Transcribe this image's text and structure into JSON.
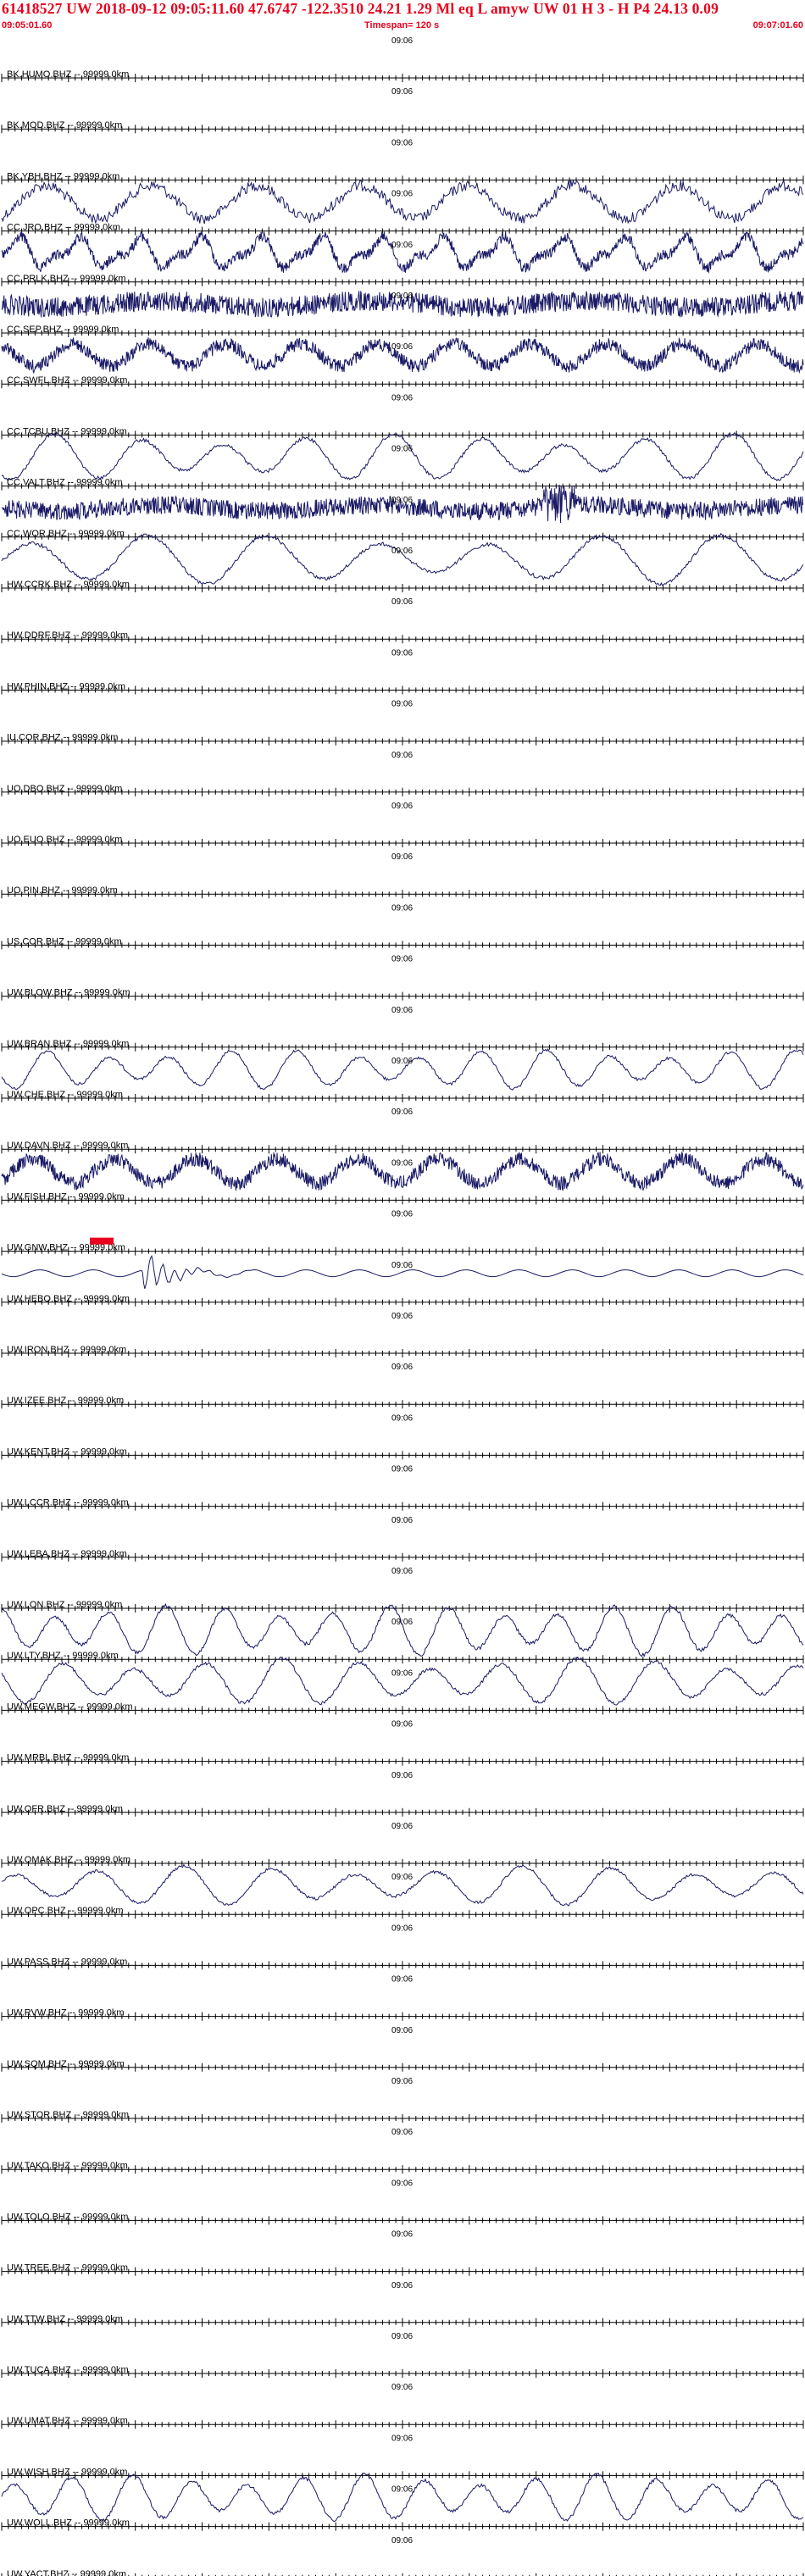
{
  "header": {
    "title": "61418527 UW 2018-09-12 09:05:11.60    47.6747 -122.3510  24.21  1.29 Ml  eq  L amyw     UW 01  H   3   -  H P4   24.13  0.09",
    "start_time": "09:05:01.60",
    "timespan": "Timespan= 120 s",
    "end_time": "09:07:01.60"
  },
  "colors": {
    "header": "#e8001c",
    "trace": "#1a1a66",
    "axis": "#000000",
    "pick": "#e8001c"
  },
  "chart_data": {
    "type": "line",
    "title": "61418527 UW 2018-09-12 09:05:11.60",
    "time_label": "09:06",
    "xlim": [
      0,
      120
    ],
    "traces": [
      {
        "label": "BK.HUMO.BHZ -- 99999.0km",
        "amp": 0,
        "mode": "flat"
      },
      {
        "label": "BK.MOD.BHZ -- 99999.0km",
        "amp": 0,
        "mode": "flat"
      },
      {
        "label": "BK.YBH.BHZ -- 99999.0km",
        "amp": 28,
        "mode": "mixed"
      },
      {
        "label": "CC.JRO.BHZ -- 99999.0km",
        "amp": 24,
        "mode": "fast"
      },
      {
        "label": "CC.PRLK.BHZ -- 99999.0km",
        "amp": 20,
        "mode": "noise"
      },
      {
        "label": "CC.SEP.BHZ -- 99999.0km",
        "amp": 22,
        "mode": "noisy"
      },
      {
        "label": "CC.SWFL.BHZ -- 99999.0km",
        "amp": 0,
        "mode": "flat"
      },
      {
        "label": "CC.TCBU.BHZ -- 99999.0km",
        "amp": 26,
        "mode": "slow"
      },
      {
        "label": "CC.VALT.BHZ -- 99999.0km",
        "amp": 18,
        "mode": "noise"
      },
      {
        "label": "CC.WOR.BHZ -- 99999.0km",
        "amp": 28,
        "mode": "slow"
      },
      {
        "label": "HW.CCRK.BHZ -- 99999.0km",
        "amp": 0,
        "mode": "flat"
      },
      {
        "label": "HW.DDRF.BHZ -- 99999.0km",
        "amp": 0,
        "mode": "flat"
      },
      {
        "label": "HW.PHIN.BHZ -- 99999.0km",
        "amp": 0,
        "mode": "flat"
      },
      {
        "label": "IU.COR.BHZ -- 99999.0km",
        "amp": 0,
        "mode": "flat"
      },
      {
        "label": "UO.DBO.BHZ -- 99999.0km",
        "amp": 0,
        "mode": "flat"
      },
      {
        "label": "UO.EUO.BHZ -- 99999.0km",
        "amp": 0,
        "mode": "flat"
      },
      {
        "label": "UO.PIN.BHZ -- 99999.0km",
        "amp": 0,
        "mode": "flat"
      },
      {
        "label": "US.COR.BHZ -- 99999.0km",
        "amp": 0,
        "mode": "flat"
      },
      {
        "label": "UW.BLOW.BHZ -- 99999.0km",
        "amp": 0,
        "mode": "flat"
      },
      {
        "label": "UW.BRAN.BHZ -- 99999.0km",
        "amp": 22,
        "mode": "slow"
      },
      {
        "label": "UW.CHE.BHZ -- 99999.0km",
        "amp": 0,
        "mode": "flat"
      },
      {
        "label": "UW.DAVN.BHZ -- 99999.0km",
        "amp": 24,
        "mode": "noisy"
      },
      {
        "label": "UW.FISH.BHZ -- 99999.0km",
        "amp": 0,
        "mode": "flat"
      },
      {
        "label": "UW.GNW.BHZ -- 99999.0km",
        "amp": 10,
        "mode": "quake"
      },
      {
        "label": "UW.HEBO.BHZ -- 99999.0km",
        "amp": 0,
        "mode": "flat"
      },
      {
        "label": "UW.IRON.BHZ -- 99999.0km",
        "amp": 0,
        "mode": "flat"
      },
      {
        "label": "UW.IZEE.BHZ -- 99999.0km",
        "amp": 0,
        "mode": "flat"
      },
      {
        "label": "UW.KENT.BHZ -- 99999.0km",
        "amp": 0,
        "mode": "flat"
      },
      {
        "label": "UW.LCCR.BHZ -- 99999.0km",
        "amp": 0,
        "mode": "flat"
      },
      {
        "label": "UW.LEBA.BHZ -- 99999.0km",
        "amp": 0,
        "mode": "flat"
      },
      {
        "label": "UW.LON.BHZ -- 99999.0km",
        "amp": 28,
        "mode": "slow"
      },
      {
        "label": "UW.LTY.BHZ -- 99999.0km",
        "amp": 26,
        "mode": "slow"
      },
      {
        "label": "UW.MEGW.BHZ -- 99999.0km",
        "amp": 0,
        "mode": "flat"
      },
      {
        "label": "UW.MRBL.BHZ -- 99999.0km",
        "amp": 0,
        "mode": "flat"
      },
      {
        "label": "UW.OFR.BHZ -- 99999.0km",
        "amp": 0,
        "mode": "flat"
      },
      {
        "label": "UW.OMAK.BHZ -- 99999.0km",
        "amp": 22,
        "mode": "slow"
      },
      {
        "label": "UW.OPC.BHZ -- 99999.0km",
        "amp": 0,
        "mode": "flat"
      },
      {
        "label": "UW.PASS.BHZ -- 99999.0km",
        "amp": 0,
        "mode": "flat"
      },
      {
        "label": "UW.RVW.BHZ -- 99999.0km",
        "amp": 0,
        "mode": "flat"
      },
      {
        "label": "UW.SQM.BHZ -- 99999.0km",
        "amp": 0,
        "mode": "flat"
      },
      {
        "label": "UW.STOR.BHZ -- 99999.0km",
        "amp": 0,
        "mode": "flat"
      },
      {
        "label": "UW.TAKO.BHZ -- 99999.0km",
        "amp": 0,
        "mode": "flat"
      },
      {
        "label": "UW.TOLO.BHZ -- 99999.0km",
        "amp": 0,
        "mode": "flat"
      },
      {
        "label": "UW.TREE.BHZ -- 99999.0km",
        "amp": 0,
        "mode": "flat"
      },
      {
        "label": "UW.TTW.BHZ -- 99999.0km",
        "amp": 0,
        "mode": "flat"
      },
      {
        "label": "UW.TUCA.BHZ -- 99999.0km",
        "amp": 0,
        "mode": "flat"
      },
      {
        "label": "UW.UMAT.BHZ -- 99999.0km",
        "amp": 0,
        "mode": "flat"
      },
      {
        "label": "UW.WISH.BHZ -- 99999.0km",
        "amp": 26,
        "mode": "slow"
      },
      {
        "label": "UW.WOLL.BHZ -- 99999.0km",
        "amp": 0,
        "mode": "flat"
      },
      {
        "label": "UW.YACT.BHZ -- 99999.0km",
        "amp": 0,
        "mode": "flat"
      }
    ]
  }
}
